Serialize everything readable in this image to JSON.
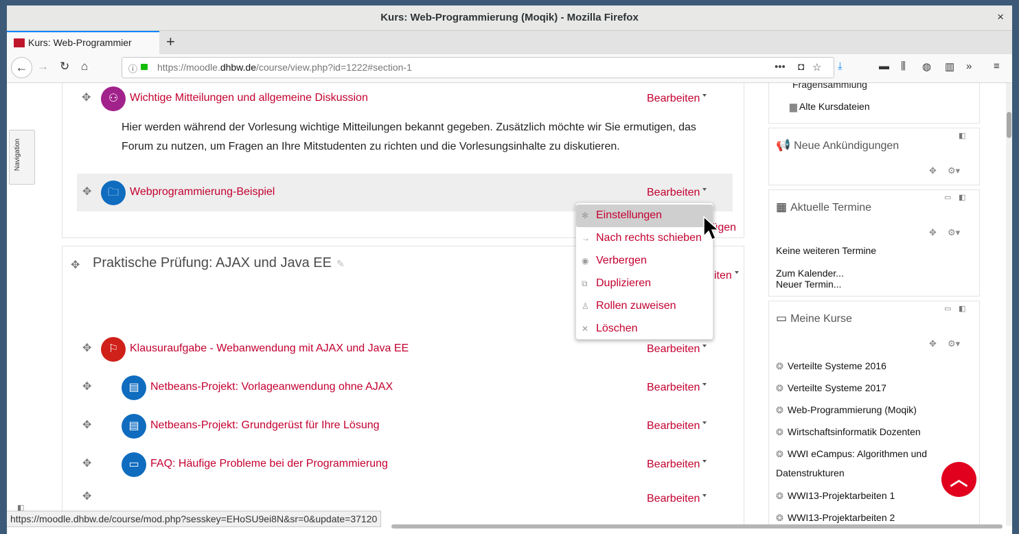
{
  "window": {
    "title": "Kurs: Web-Programmierung (Moqik) - Mozilla Firefox",
    "close": "×"
  },
  "tabs": [
    {
      "label": "Kurs: Web-Programmier",
      "close": "×"
    }
  ],
  "newtab": "+",
  "url": {
    "pre": "https://moodle.",
    "domain": "dhbw.de",
    "path": "/course/view.php?id=1222#section-1"
  },
  "nav_block": {
    "label": "Navigation"
  },
  "section1": {
    "forum": {
      "title": "Wichtige Mitteilungen und allgemeine Diskussion",
      "edit": "Bearbeiten"
    },
    "description": "Hier werden während der Vorlesung wichtige Mitteilungen bekannt gegeben. Zusätzlich möchte wir Sie ermutigen, das Forum zu nutzen, um Fragen an Ihre Mitstudenten zu richten und die Vorlesungsinhalte zu diskutieren.",
    "folder": {
      "title": "Webprogrammierung-Beispiel",
      "edit": "Bearbeiten"
    },
    "add": "fügen"
  },
  "section2": {
    "title": "Praktische Prüfung: AJAX und Java EE",
    "edit_partial": "iten",
    "items": [
      {
        "title": "Klausuraufgabe - Webanwendung mit AJAX und Java EE",
        "edit": "Bearbeiten"
      },
      {
        "title": "Netbeans-Projekt: Vorlageanwendung ohne AJAX",
        "edit": "Bearbeiten"
      },
      {
        "title": "Netbeans-Projekt: Grundgerüst für Ihre Lösung",
        "edit": "Bearbeiten"
      },
      {
        "title": "FAQ: Häufige Probleme bei der Programmierung",
        "edit": "Bearbeiten"
      },
      {
        "title": "",
        "edit": "Bearbeiten"
      }
    ]
  },
  "context_menu": [
    {
      "label": "Einstellungen",
      "icon": "gear-icon"
    },
    {
      "label": "Nach rechts schieben",
      "icon": "arrow-right-icon"
    },
    {
      "label": "Verbergen",
      "icon": "eye-icon"
    },
    {
      "label": "Duplizieren",
      "icon": "copy-icon"
    },
    {
      "label": "Rollen zuweisen",
      "icon": "user-plus-icon"
    },
    {
      "label": "Löschen",
      "icon": "x-icon"
    }
  ],
  "sidebar": {
    "files_block": {
      "item1": "Fragensammlung",
      "item2": "Alte Kursdateien"
    },
    "announcements": {
      "title": "Neue Ankündigungen"
    },
    "events": {
      "title": "Aktuelle Termine",
      "none": "Keine weiteren Termine",
      "calendar": "Zum Kalender...",
      "new_event": "Neuer Termin..."
    },
    "courses": {
      "title": "Meine Kurse",
      "items": [
        "Verteilte Systeme 2016",
        "Verteilte Systeme 2017",
        "Web-Programmierung (Moqik)",
        "Wirtschaftsinformatik Dozenten",
        "WWI eCampus: Algorithmen und",
        "WWI13-Projektarbeiten 1",
        "WWI13-Projektarbeiten 2"
      ],
      "wrap": "Datenstrukturen"
    }
  },
  "statusbar": "https://moodle.dhbw.de/course/mod.php?sesskey=EHoSU9ei8N&sr=0&update=37120",
  "colors": {
    "link": "#c3002f",
    "accent": "#0a84ff",
    "totop": "#e1001e"
  }
}
